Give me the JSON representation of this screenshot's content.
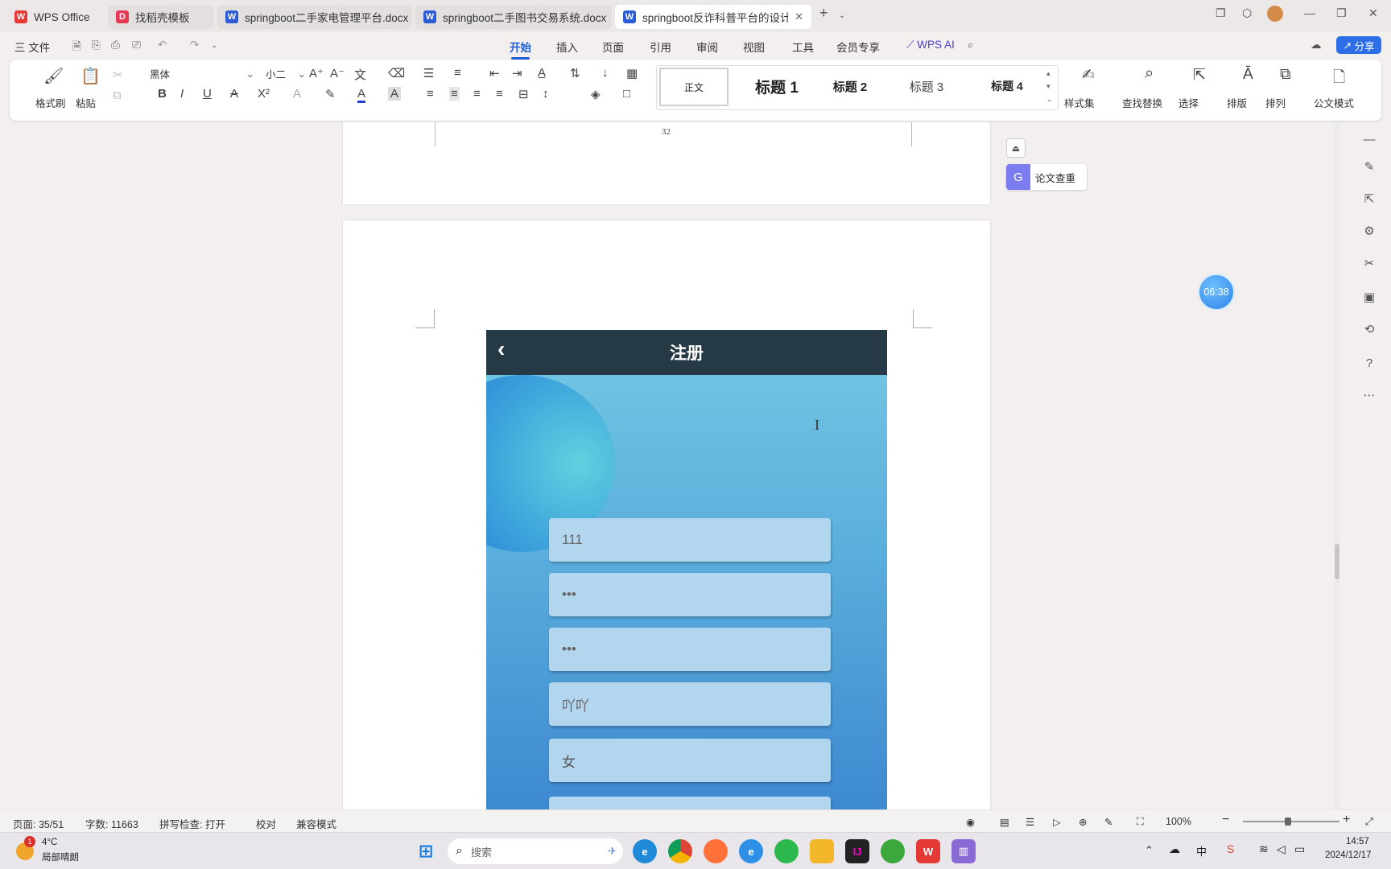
{
  "tabs": [
    {
      "label": "WPS Office",
      "icon": "W",
      "color": "#e53935"
    },
    {
      "label": "找稻壳模板",
      "icon": "D",
      "color": "#e53955"
    },
    {
      "label": "springboot二手家电管理平台.docx",
      "icon": "W",
      "color": "#2b5bd7"
    },
    {
      "label": "springboot二手图书交易系统.docx",
      "icon": "W",
      "color": "#2b5bd7"
    },
    {
      "label": "springboot反诈科普平台的设计与",
      "icon": "W",
      "color": "#2b5bd7"
    }
  ],
  "menu": {
    "file": "三 文件",
    "items": [
      "开始",
      "插入",
      "页面",
      "引用",
      "审阅",
      "视图",
      "工具",
      "会员专享"
    ],
    "wps_ai": "WPS AI",
    "share": "分享"
  },
  "ribbon": {
    "format_painter": "格式刷",
    "paste": "粘贴",
    "font_name": "黑体",
    "font_size": "小二",
    "styles": [
      "正文",
      "标题 1",
      "标题 2",
      "标题 3",
      "标题 4"
    ],
    "style_set": "样式集",
    "find_replace": "查找替换",
    "select": "选择",
    "layout": "排版",
    "arrange": "排列",
    "official": "公文模式"
  },
  "document": {
    "page_number": "32",
    "register_title": "注册",
    "fields": [
      "111",
      "•••",
      "•••",
      "吖吖",
      "女"
    ]
  },
  "side": {
    "paper_check": "论文查重",
    "timer": "06:38"
  },
  "status": {
    "page": "页面: 35/51",
    "words": "字数: 11663",
    "spell": "拼写检查: 打开",
    "proof": "校对",
    "compat": "兼容模式",
    "zoom": "100%"
  },
  "taskbar": {
    "weather_temp": "4°C",
    "weather_desc": "局部晴朗",
    "weather_badge": "1",
    "search_placeholder": "搜索",
    "time": "14:57",
    "date": "2024/12/17",
    "ime": "中"
  },
  "colors": {
    "accent": "#1e5fd8",
    "app_header": "#263a45",
    "app_bg_top": "#74c8e4",
    "app_bg_bottom": "#3b86cf",
    "field": "#b3d6ef"
  }
}
